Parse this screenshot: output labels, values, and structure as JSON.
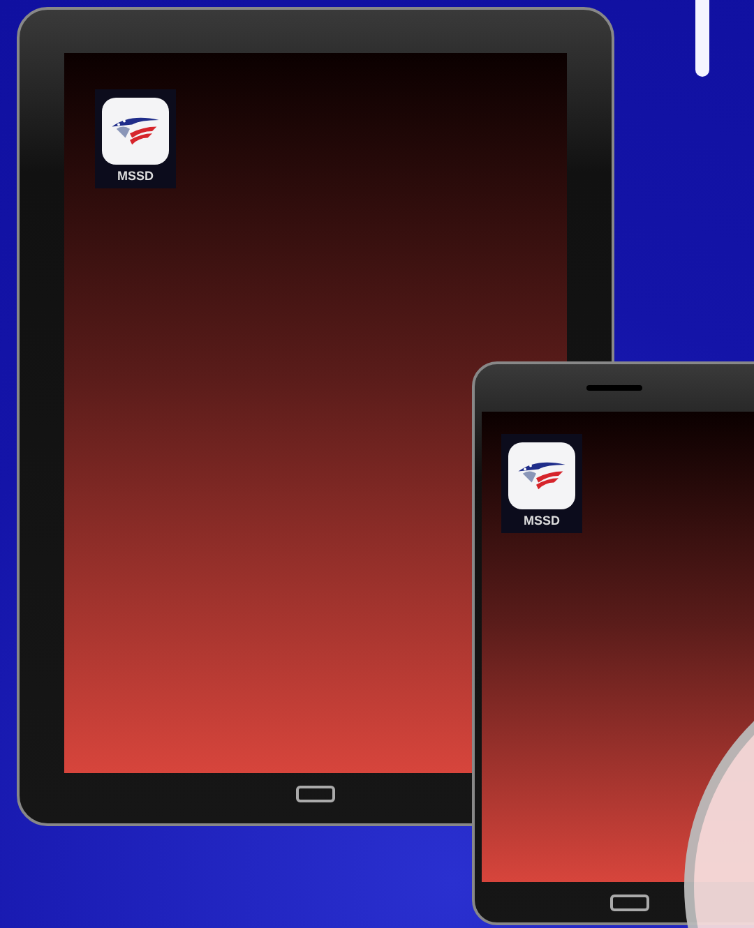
{
  "tablet": {
    "apps": [
      {
        "label": "MSSD"
      }
    ]
  },
  "phone": {
    "apps": [
      {
        "label": "MSSD"
      }
    ]
  }
}
